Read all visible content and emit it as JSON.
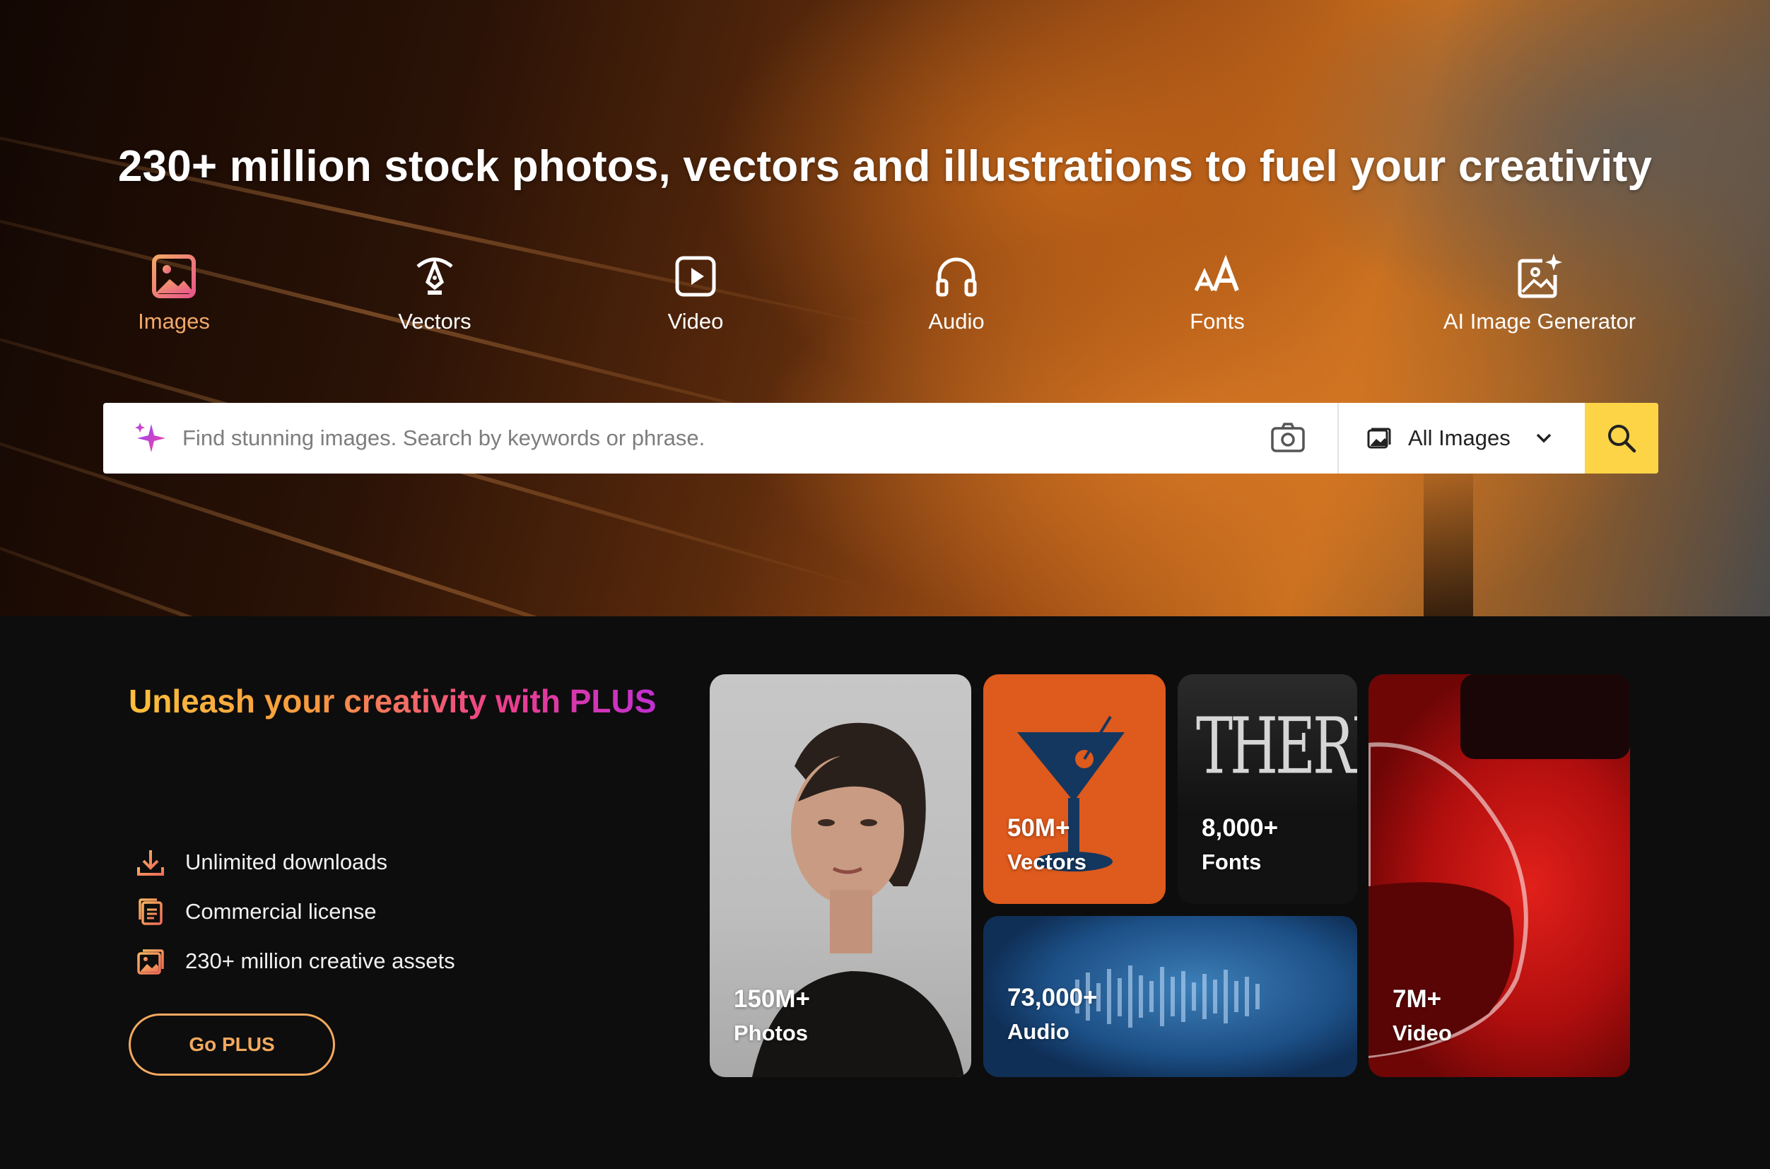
{
  "hero": {
    "headline": "230+ million stock photos, vectors and illustrations to fuel your creativity",
    "categories": [
      {
        "label": "Images",
        "icon": "image-icon",
        "active": true
      },
      {
        "label": "Vectors",
        "icon": "pen-tool-icon",
        "active": false
      },
      {
        "label": "Video",
        "icon": "play-icon",
        "active": false
      },
      {
        "label": "Audio",
        "icon": "headphones-icon",
        "active": false
      },
      {
        "label": "Fonts",
        "icon": "font-size-icon",
        "active": false
      },
      {
        "label": "AI Image Generator",
        "icon": "ai-image-icon",
        "active": false
      }
    ]
  },
  "search": {
    "placeholder": "Find stunning images. Search by keywords or phrase.",
    "value": "",
    "type_selected": "All Images",
    "icons": [
      "sparkle-icon",
      "camera-icon",
      "image-icon",
      "chevron-down-icon",
      "search-icon"
    ]
  },
  "plus": {
    "title": "Unleash your creativity with PLUS",
    "perks": [
      {
        "label": "Unlimited downloads",
        "icon": "download-icon"
      },
      {
        "label": "Commercial license",
        "icon": "license-icon"
      },
      {
        "label": "230+ million creative assets",
        "icon": "images-icon"
      }
    ],
    "cta": "Go PLUS"
  },
  "tiles": {
    "photos": {
      "count": "150M+",
      "kind": "Photos"
    },
    "vectors": {
      "count": "50M+",
      "kind": "Vectors"
    },
    "fonts": {
      "count": "8,000+",
      "kind": "Fonts",
      "sample": "THERLALU"
    },
    "audio": {
      "count": "73,000+",
      "kind": "Audio"
    },
    "video": {
      "count": "7M+",
      "kind": "Video"
    }
  },
  "colors": {
    "accent_orange": "#f2a86a",
    "search_button": "#fcd446",
    "plus_gradient": [
      "#fcbf3c",
      "#ee3f8b",
      "#c12fd1"
    ],
    "background_dark": "#0d0d0d"
  }
}
